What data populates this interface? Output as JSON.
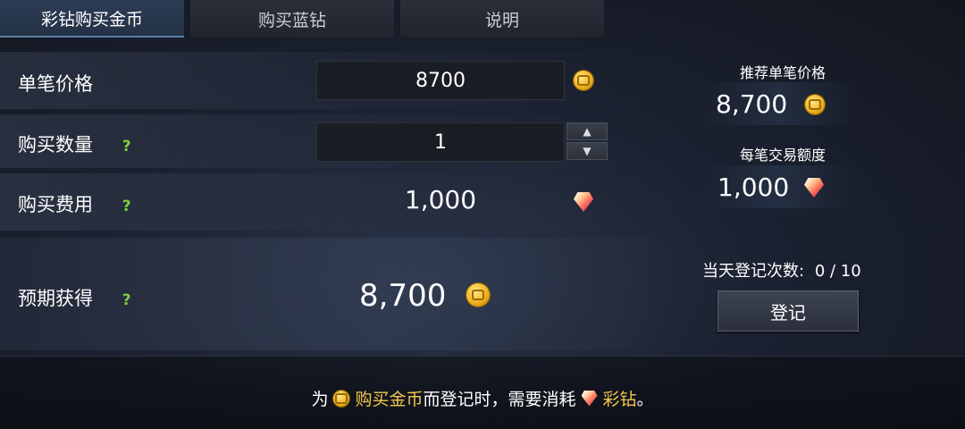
{
  "tabs": [
    {
      "label": "彩钻购买金币",
      "active": true
    },
    {
      "label": "购买蓝钻",
      "active": false
    },
    {
      "label": "说明",
      "active": false
    }
  ],
  "form": {
    "unit_price": {
      "label": "单笔价格",
      "value": "8700",
      "icon": "gold-coin-icon"
    },
    "quantity": {
      "label": "购买数量",
      "help": "?",
      "value": "1"
    },
    "cost": {
      "label": "购买费用",
      "help": "?",
      "value": "1,000",
      "icon": "color-diamond-icon"
    },
    "expected": {
      "label": "预期获得",
      "help": "?",
      "value": "8,700",
      "icon": "gold-coin-icon"
    }
  },
  "side": {
    "recommended": {
      "title": "推荐单笔价格",
      "value": "8,700"
    },
    "limit": {
      "title": "每笔交易额度",
      "value": "1,000"
    },
    "register_count": {
      "label": "当天登记次数:",
      "value": "0 / 10"
    },
    "register_button": "登记"
  },
  "note": {
    "prefix": "为",
    "highlight1": "购买金币",
    "middle": "而登记时，需要消耗",
    "highlight2": "彩钻",
    "suffix": "。"
  },
  "colors": {
    "accent_gold": "#f4c84a",
    "help_green": "#7fcf3c"
  }
}
